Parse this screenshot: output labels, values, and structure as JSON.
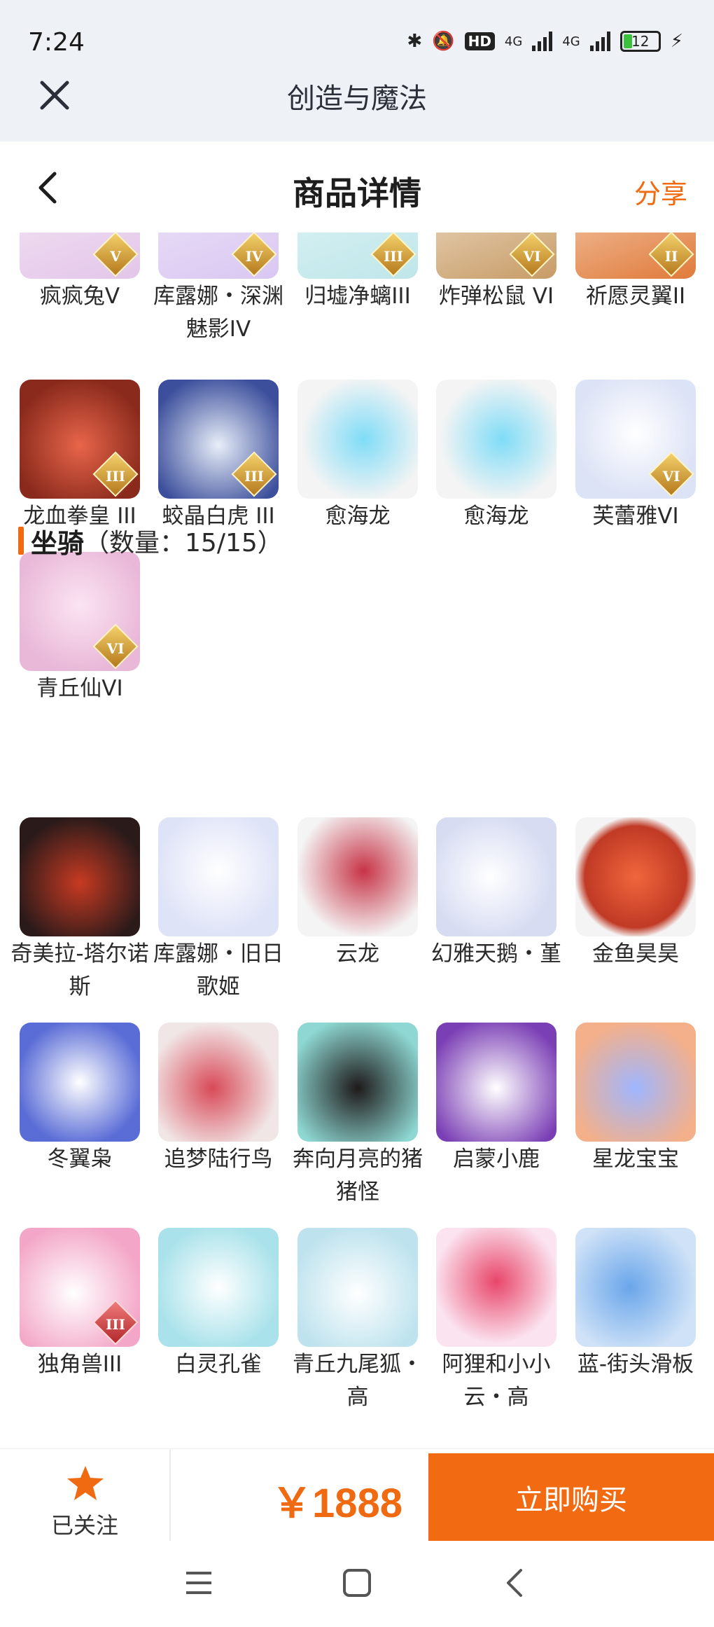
{
  "status": {
    "time": "7:24",
    "hd": "HD",
    "net1": "4G",
    "net2": "4G",
    "battery": "12"
  },
  "app": {
    "title": "创造与魔法"
  },
  "page": {
    "title": "商品详情",
    "share": "分享"
  },
  "pets_partial": [
    {
      "name": "疯疯兔V",
      "badge": "V"
    },
    {
      "name": "库露娜・深渊魅影IV",
      "badge": "IV"
    },
    {
      "name": "归墟净螭III",
      "badge": "III"
    },
    {
      "name": "炸弹松鼠 VI",
      "badge": "VI"
    },
    {
      "name": "祈愿灵翼II",
      "badge": "II"
    }
  ],
  "pets": [
    {
      "name": "龙血拳皇 III",
      "badge": "III"
    },
    {
      "name": "蛟晶白虎 III",
      "badge": "III"
    },
    {
      "name": "愈海龙",
      "badge": ""
    },
    {
      "name": "愈海龙",
      "badge": ""
    },
    {
      "name": "芙蕾雅VI",
      "badge": "VI"
    },
    {
      "name": "青丘仙VI",
      "badge": "VI"
    }
  ],
  "mounts_section": {
    "name": "坐骑",
    "count": "（数量：15/15）"
  },
  "mounts": [
    {
      "name": "奇美拉-塔尔诺斯"
    },
    {
      "name": "库露娜・旧日歌姬"
    },
    {
      "name": "云龙"
    },
    {
      "name": "幻雅天鹅・堇"
    },
    {
      "name": "金鱼昊昊"
    },
    {
      "name": "冬翼枭"
    },
    {
      "name": "追梦陆行鸟"
    },
    {
      "name": "奔向月亮的猪猪怪"
    },
    {
      "name": "启蒙小鹿"
    },
    {
      "name": "星龙宝宝"
    },
    {
      "name": "独角兽III",
      "badge": "III"
    },
    {
      "name": "白灵孔雀"
    },
    {
      "name": "青丘九尾狐・高"
    },
    {
      "name": "阿狸和小小云・高"
    },
    {
      "name": "蓝-街头滑板"
    }
  ],
  "bottom": {
    "follow": "已关注",
    "price": "￥1888",
    "buy": "立即购买"
  },
  "colors": {
    "accent": "#f06a12",
    "header_bg": "#eef2f7"
  }
}
